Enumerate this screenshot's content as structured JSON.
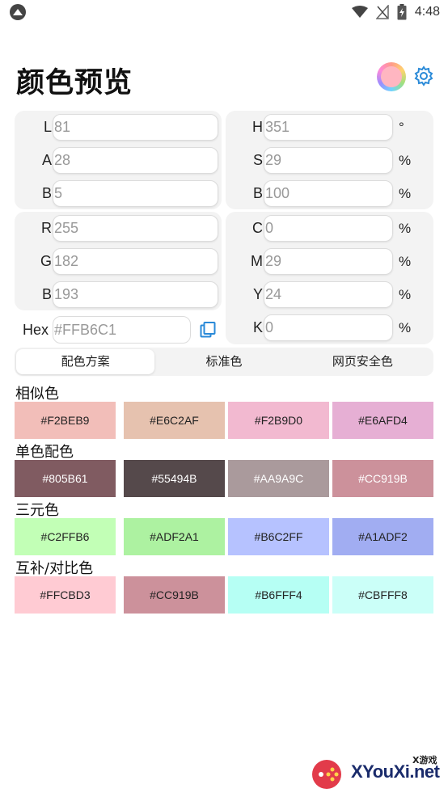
{
  "status_bar": {
    "time": "4:48"
  },
  "header": {
    "title": "颜色预览",
    "current_color": "#FFB6C1",
    "accent": "#2a8ad8"
  },
  "lab": [
    {
      "label": "L",
      "value": "81"
    },
    {
      "label": "A",
      "value": "28"
    },
    {
      "label": "B",
      "value": "5"
    }
  ],
  "hsb": [
    {
      "label": "H",
      "value": "351",
      "unit": "°"
    },
    {
      "label": "S",
      "value": "29",
      "unit": "%"
    },
    {
      "label": "B",
      "value": "100",
      "unit": "%"
    }
  ],
  "rgb": [
    {
      "label": "R",
      "value": "255"
    },
    {
      "label": "G",
      "value": "182"
    },
    {
      "label": "B",
      "value": "193"
    }
  ],
  "cmyk": [
    {
      "label": "C",
      "value": "0",
      "unit": "%"
    },
    {
      "label": "M",
      "value": "29",
      "unit": "%"
    },
    {
      "label": "Y",
      "value": "24",
      "unit": "%"
    },
    {
      "label": "K",
      "value": "0",
      "unit": "%"
    }
  ],
  "hex": {
    "label": "Hex",
    "value": "#FFB6C1"
  },
  "tabs": [
    {
      "label": "配色方案",
      "active": true
    },
    {
      "label": "标准色",
      "active": false
    },
    {
      "label": "网页安全色",
      "active": false
    }
  ],
  "schemes": [
    {
      "title": "相似色",
      "text_color": "#222222",
      "colors": [
        "#F2BEB9",
        "#E6C2AF",
        "#F2B9D0",
        "#E6AFD4"
      ]
    },
    {
      "title": "单色配色",
      "text_color": "#ffffff",
      "colors": [
        "#805B61",
        "#55494B",
        "#AA9A9C",
        "#CC919B"
      ]
    },
    {
      "title": "三元色",
      "text_color": "#222222",
      "colors": [
        "#C2FFB6",
        "#ADF2A1",
        "#B6C2FF",
        "#A1ADF2"
      ]
    },
    {
      "title": "互补/对比色",
      "text_color": "#222222",
      "colors": [
        "#FFCBD3",
        "#CC919B",
        "#B6FFF4",
        "#CBFFF8"
      ]
    }
  ],
  "watermark": {
    "text": "XYouXi.net",
    "small": "X游戏"
  }
}
